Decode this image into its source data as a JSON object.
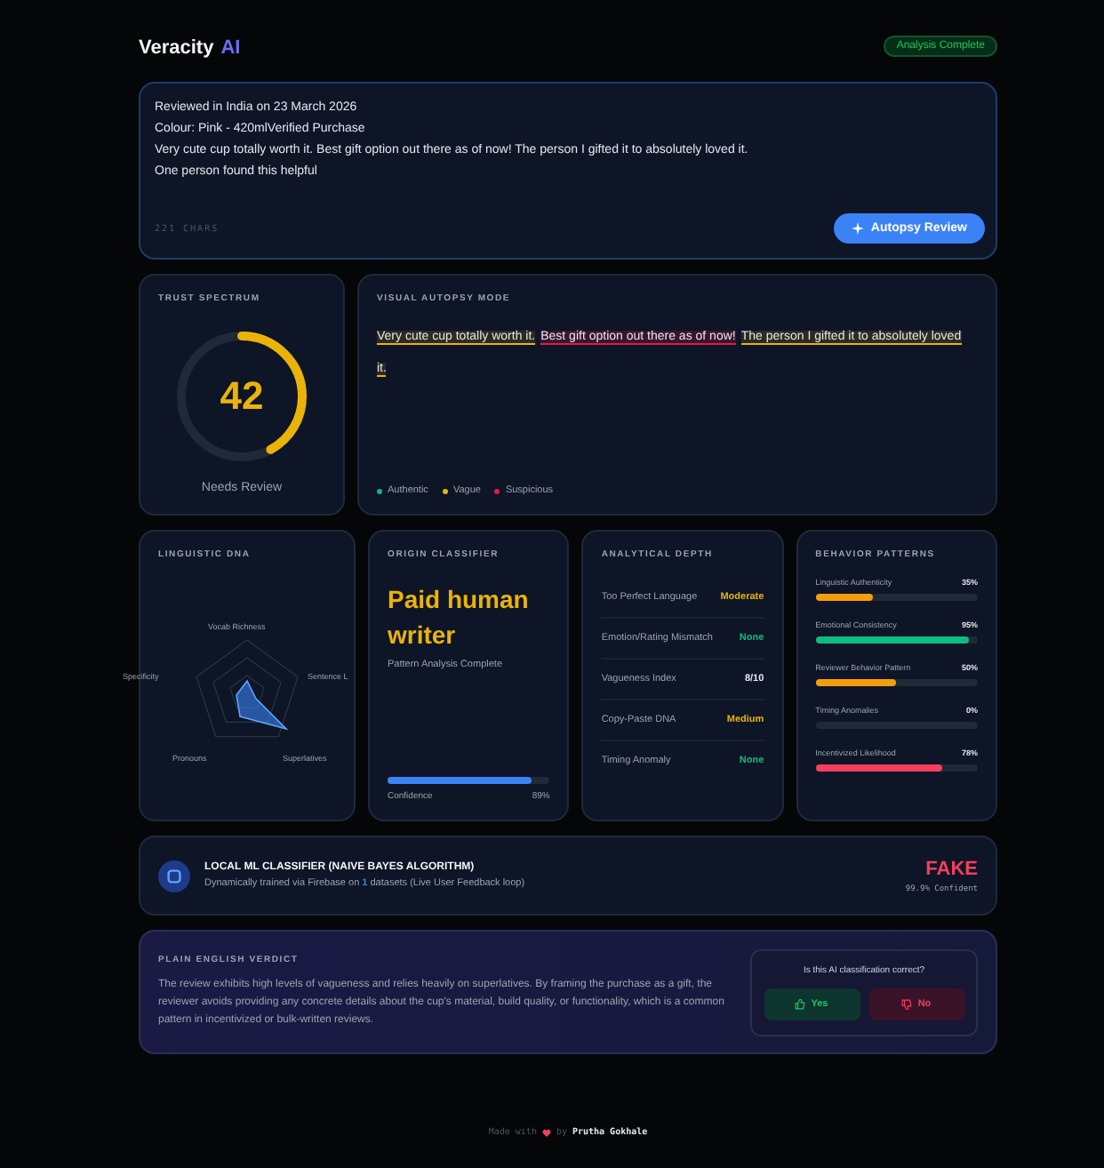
{
  "header": {
    "brand": "Veracity",
    "brand_accent": "AI",
    "status_badge": "Analysis Complete"
  },
  "input": {
    "lines": [
      "Reviewed in India on 23 March 2026",
      "Colour: Pink - 420mlVerified Purchase",
      "Very cute cup totally worth it. Best gift option out there as of now! The person I gifted it to absolutely loved it.",
      "One person found this helpful"
    ],
    "char_count": "221 CHARS",
    "button": "Autopsy Review"
  },
  "trust": {
    "title": "TRUST SPECTRUM",
    "score": "42",
    "label": "Needs Review"
  },
  "autopsy": {
    "title": "VISUAL AUTOPSY MODE",
    "segments": [
      {
        "text": "Very cute cup totally worth it.",
        "kind": "vague"
      },
      {
        "text": "Best gift option out there as of now!",
        "kind": "suspicious"
      },
      {
        "text": "The person I gifted it to absolutely loved it.",
        "kind": "vague"
      }
    ],
    "legend": [
      {
        "label": "Authentic",
        "color": "#10b981"
      },
      {
        "label": "Vague",
        "color": "#eab308"
      },
      {
        "label": "Suspicious",
        "color": "#e11d48"
      }
    ]
  },
  "dna": {
    "title": "LINGUISTIC DNA",
    "axes": [
      "Vocab Richness",
      "Sentence L",
      "Superlatives",
      "Pronouns",
      "Specificity"
    ]
  },
  "origin": {
    "title": "ORIGIN CLASSIFIER",
    "verdict": "Paid human writer",
    "subtitle": "Pattern Analysis Complete",
    "confidence_label": "Confidence",
    "confidence_value": "89%",
    "level": 0.89
  },
  "depth": {
    "title": "ANALYTICAL DEPTH",
    "rows": [
      {
        "label": "Too Perfect Language",
        "value": "Moderate",
        "color": "#eab308"
      },
      {
        "label": "Emotion/Rating Mismatch",
        "value": "None",
        "color": "#10b981"
      },
      {
        "label": "Vagueness Index",
        "value": "8/10",
        "color": "#e5e7eb"
      },
      {
        "label": "Copy-Paste DNA",
        "value": "Medium",
        "color": "#eab308"
      },
      {
        "label": "Timing Anomaly",
        "value": "None",
        "color": "#10b981"
      }
    ]
  },
  "behavior": {
    "title": "BEHAVIOR PATTERNS",
    "rows": [
      {
        "label": "Linguistic Authenticity",
        "value": "35%",
        "level": 0.35,
        "color": "#f59e0b"
      },
      {
        "label": "Emotional Consistency",
        "value": "95%",
        "level": 0.95,
        "color": "#10b981"
      },
      {
        "label": "Reviewer Behavior Pattern",
        "value": "50%",
        "level": 0.5,
        "color": "#f59e0b"
      },
      {
        "label": "Timing Anomalies",
        "value": "0%"
      },
      {
        "label": "Incentivized Likelihood",
        "value": "78%",
        "level": 0.78,
        "color": "#f43f5e"
      }
    ]
  },
  "ml": {
    "title": "LOCAL ML CLASSIFIER (NAIVE BAYES ALGORITHM)",
    "subtitle": "Dynamically trained via Firebase on **1** datasets (Live User Feedback loop)",
    "result": "FAKE",
    "confidence": "99.9% Confident"
  },
  "verdict": {
    "title": "PLAIN ENGLISH VERDICT",
    "text": "The review exhibits high levels of vagueness and relies heavily on superlatives. By framing the purchase as a gift, the reviewer avoids providing any concrete details about the cup's material, build quality, or functionality, which is a common pattern in incentivized or bulk-written reviews.",
    "question": "Is this AI classification correct?",
    "yes": "Yes",
    "no": "No"
  },
  "footer": {
    "prefix": "Made with",
    "by": "by",
    "author": "Prutha Gokhale"
  }
}
